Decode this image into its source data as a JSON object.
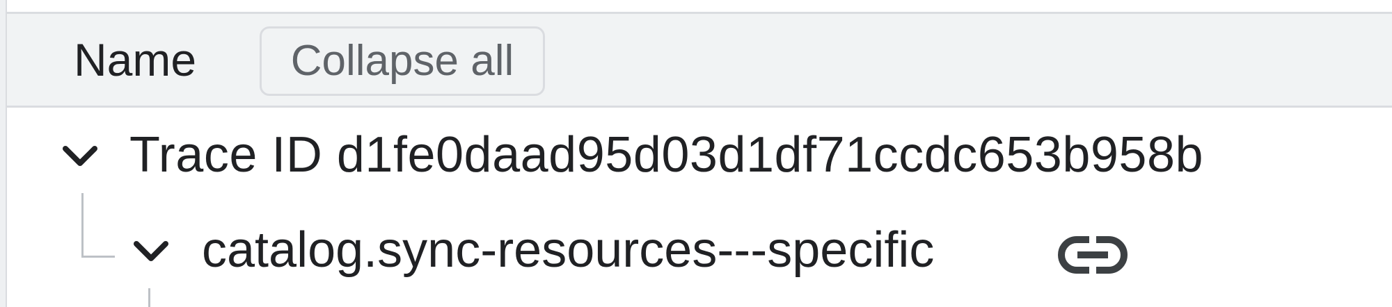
{
  "header": {
    "title": "Name",
    "collapse_label": "Collapse all"
  },
  "rows": [
    {
      "label": "Trace ID d1fe0daad95d03d1df71ccdc653b958b",
      "expanded": true,
      "icon": "chevron-down-icon"
    },
    {
      "label": "catalog.sync-resources---specific",
      "expanded": true,
      "icon": "chevron-down-icon",
      "trailing_icon": "link-icon"
    }
  ],
  "colors": {
    "header_bg": "#f1f3f4",
    "border": "#dadce0",
    "text": "#202124",
    "muted_text": "#5f6368",
    "tree_line": "#bdc1c6"
  }
}
